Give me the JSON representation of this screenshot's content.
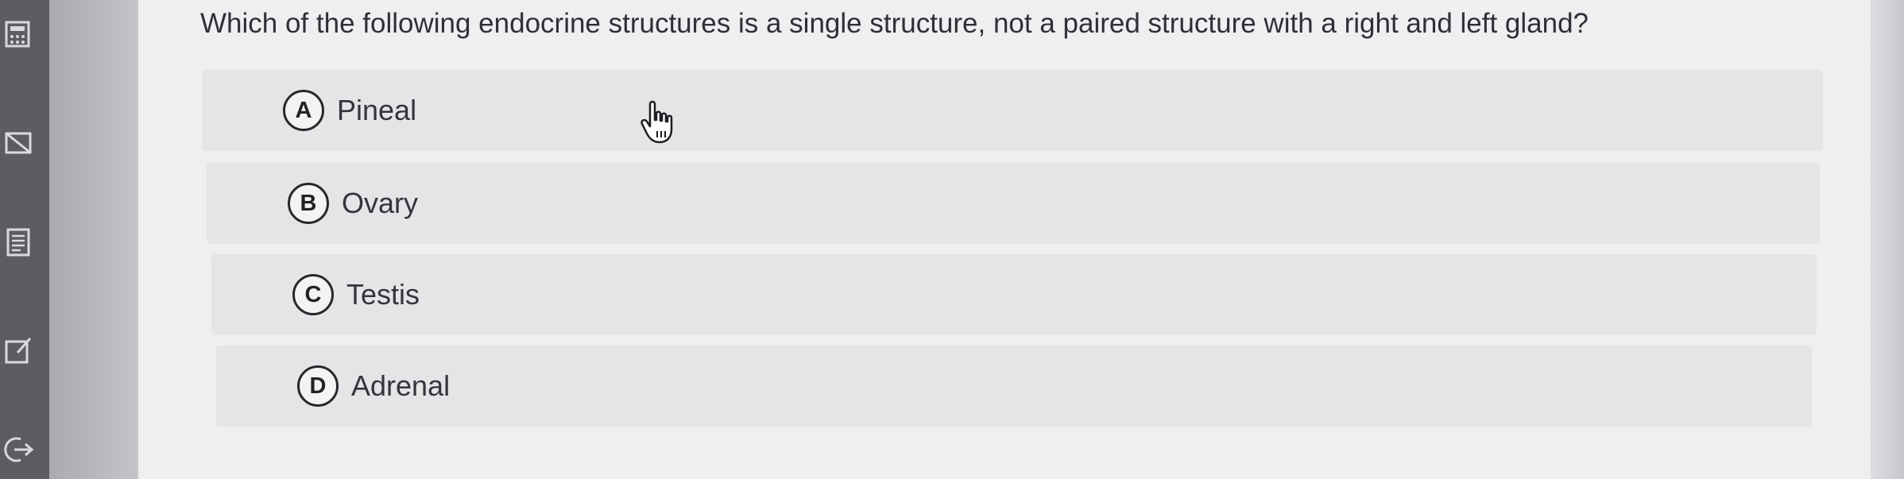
{
  "question": {
    "text": "Which of the following endocrine structures is a single structure, not a paired structure with a right and left gland?"
  },
  "options": [
    {
      "letter": "A",
      "label": "Pineal"
    },
    {
      "letter": "B",
      "label": "Ovary"
    },
    {
      "letter": "C",
      "label": "Testis"
    },
    {
      "letter": "D",
      "label": "Adrenal"
    }
  ],
  "sidebar": {
    "icons": [
      "calculator-icon",
      "flag-icon",
      "notes-icon",
      "edit-icon",
      "exit-icon"
    ]
  },
  "colors": {
    "content_bg": "#eeeff0",
    "option_bg": "#e4e5e7",
    "sidebar_bg": "#5b5d61",
    "text": "#2f3035"
  }
}
